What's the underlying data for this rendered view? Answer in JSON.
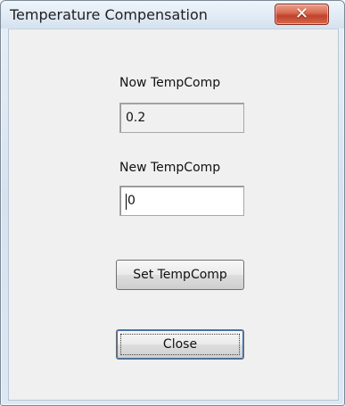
{
  "window": {
    "title": "Temperature Compensation"
  },
  "titlebar": {
    "close_glyph": "✕",
    "icon_name": "close-icon"
  },
  "fields": {
    "now_label": "Now TempComp",
    "now_value": "0.2",
    "new_label": "New TempComp",
    "new_value": "0"
  },
  "buttons": {
    "set_label": "Set TempComp",
    "close_label": "Close"
  },
  "colors": {
    "window_frame": "#dce8f3",
    "client_background": "#f0f0f0",
    "close_button": "#c1412d"
  }
}
